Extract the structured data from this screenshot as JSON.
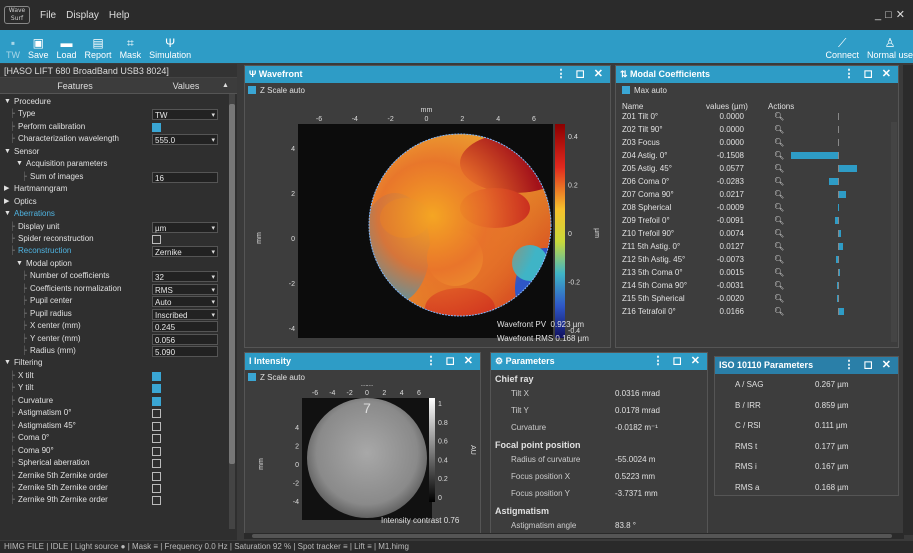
{
  "app": {
    "logo": "Wave Surf",
    "menus": [
      "File",
      "Display",
      "Help"
    ]
  },
  "toolbar": {
    "items": [
      {
        "label": "TW",
        "icon": "camera-icon",
        "enabled": false
      },
      {
        "label": "Save",
        "icon": "save-icon",
        "enabled": true
      },
      {
        "label": "Load",
        "icon": "folder-icon",
        "enabled": true
      },
      {
        "label": "Report",
        "icon": "report-icon",
        "enabled": true
      },
      {
        "label": "Mask",
        "icon": "mask-icon",
        "enabled": true
      },
      {
        "label": "Simulation",
        "icon": "simulation-icon",
        "enabled": true
      }
    ],
    "right": [
      {
        "label": "Connect",
        "icon": "plug-icon"
      },
      {
        "label": "Normal use",
        "icon": "user-icon"
      }
    ]
  },
  "device": {
    "title": "[HASO LIFT 680 BroadBand USB3 8024]"
  },
  "features": {
    "col_features": "Features",
    "col_values": "Values",
    "rows": [
      {
        "label": "Procedure",
        "level": 0,
        "expander": "▼"
      },
      {
        "label": "Type",
        "level": 1,
        "value": "TW",
        "ctrl": "select"
      },
      {
        "label": "Perform calibration",
        "level": 1,
        "ctrl": "check",
        "checked": true
      },
      {
        "label": "Characterization wavelength",
        "level": 1,
        "value": "555.0",
        "ctrl": "spin"
      },
      {
        "label": "Sensor",
        "level": 0,
        "expander": "▼"
      },
      {
        "label": "Acquisition parameters",
        "level": 1,
        "expander": "▼"
      },
      {
        "label": "Sum of images",
        "level": 2,
        "value": "16",
        "ctrl": "text"
      },
      {
        "label": "Hartmanngram",
        "level": 0,
        "expander": "▶"
      },
      {
        "label": "Optics",
        "level": 0,
        "expander": "▶"
      },
      {
        "label": "Aberrations",
        "level": 0,
        "expander": "▼",
        "accent": true
      },
      {
        "label": "Display unit",
        "level": 1,
        "value": "µm",
        "ctrl": "select"
      },
      {
        "label": "Spider reconstruction",
        "level": 1,
        "ctrl": "check",
        "checked": false
      },
      {
        "label": "Reconstruction",
        "level": 1,
        "value": "Zernike",
        "ctrl": "select",
        "accent": true
      },
      {
        "label": "Modal option",
        "level": 1,
        "expander": "▼"
      },
      {
        "label": "Number of coefficients",
        "level": 2,
        "value": "32",
        "ctrl": "spin"
      },
      {
        "label": "Coefficients normalization",
        "level": 2,
        "value": "RMS",
        "ctrl": "select"
      },
      {
        "label": "Pupil center",
        "level": 2,
        "value": "Auto",
        "ctrl": "select"
      },
      {
        "label": "Pupil radius",
        "level": 2,
        "value": "Inscribed",
        "ctrl": "select"
      },
      {
        "label": "X center (mm)",
        "level": 2,
        "value": "0.245",
        "ctrl": "text"
      },
      {
        "label": "Y center (mm)",
        "level": 2,
        "value": "0.056",
        "ctrl": "text"
      },
      {
        "label": "Radius (mm)",
        "level": 2,
        "value": "5.090",
        "ctrl": "text"
      },
      {
        "label": "Filtering",
        "level": 0,
        "expander": "▼"
      },
      {
        "label": "X tilt",
        "level": 1,
        "ctrl": "check",
        "checked": true
      },
      {
        "label": "Y tilt",
        "level": 1,
        "ctrl": "check",
        "checked": true
      },
      {
        "label": "Curvature",
        "level": 1,
        "ctrl": "check",
        "checked": true
      },
      {
        "label": "Astigmatism 0°",
        "level": 1,
        "ctrl": "check",
        "checked": false
      },
      {
        "label": "Astigmatism 45°",
        "level": 1,
        "ctrl": "check",
        "checked": false
      },
      {
        "label": "Coma 0°",
        "level": 1,
        "ctrl": "check",
        "checked": false
      },
      {
        "label": "Coma 90°",
        "level": 1,
        "ctrl": "check",
        "checked": false
      },
      {
        "label": "Spherical aberration",
        "level": 1,
        "ctrl": "check",
        "checked": false
      },
      {
        "label": "Zernike 5th Zernike order",
        "level": 1,
        "ctrl": "check",
        "checked": false
      },
      {
        "label": "Zernike 5th Zernike order",
        "level": 1,
        "ctrl": "check",
        "checked": false
      },
      {
        "label": "Zernike 9th Zernike order",
        "level": 1,
        "ctrl": "check",
        "checked": false
      }
    ]
  },
  "wavefront": {
    "title": "Wavefront",
    "zscale": "Z Scale auto",
    "axis_unit": "mm",
    "colorbar_unit": "µm",
    "xticks": [
      "-6",
      "-4",
      "-2",
      "0",
      "2",
      "4",
      "6"
    ],
    "yticks": [
      "4",
      "2",
      "0",
      "-2",
      "-4"
    ],
    "cticks": [
      "0.4",
      "0.2",
      "0",
      "-0.2",
      "-0.4"
    ],
    "pv_label": "Wavefront PV",
    "pv_value": "0.923 µm",
    "rms_label": "Wavefront RMS",
    "rms_value": "0.168 µm"
  },
  "intensity": {
    "title": "Intensity",
    "zscale": "Z Scale auto",
    "axis_unit": "mm",
    "colorbar_unit": "AU",
    "xticks": [
      "-6",
      "-4",
      "-2",
      "0",
      "2",
      "4",
      "6"
    ],
    "yticks": [
      "4",
      "2",
      "0",
      "-2",
      "-4"
    ],
    "cticks": [
      "1",
      "0.8",
      "0.6",
      "0.4",
      "0.2",
      "0"
    ],
    "contrast_label": "Intensity contrast",
    "contrast_value": "0.76"
  },
  "modal": {
    "title": "Modal Coefficients",
    "max_auto": "Max auto",
    "col_name": "Name",
    "col_values": "values (µm)",
    "col_actions": "Actions",
    "rows": [
      {
        "name": "Z01 Tilt 0°",
        "value": "0.0000",
        "v": 0
      },
      {
        "name": "Z02 Tilt 90°",
        "value": "0.0000",
        "v": 0
      },
      {
        "name": "Z03 Focus",
        "value": "0.0000",
        "v": 0
      },
      {
        "name": "Z04 Astig. 0°",
        "value": "-0.1508",
        "v": -0.1508
      },
      {
        "name": "Z05 Astig. 45°",
        "value": "0.0577",
        "v": 0.0577
      },
      {
        "name": "Z06 Coma 0°",
        "value": "-0.0283",
        "v": -0.0283
      },
      {
        "name": "Z07 Coma 90°",
        "value": "0.0217",
        "v": 0.0217
      },
      {
        "name": "Z08 Spherical",
        "value": "-0.0009",
        "v": -0.0009
      },
      {
        "name": "Z09 Trefoil 0°",
        "value": "-0.0091",
        "v": -0.0091
      },
      {
        "name": "Z10 Trefoil 90°",
        "value": "0.0074",
        "v": 0.0074
      },
      {
        "name": "Z11 5th Astig. 0°",
        "value": "0.0127",
        "v": 0.0127
      },
      {
        "name": "Z12 5th Astig. 45°",
        "value": "-0.0073",
        "v": -0.0073
      },
      {
        "name": "Z13 5th Coma 0°",
        "value": "0.0015",
        "v": 0.0015
      },
      {
        "name": "Z14 5th Coma 90°",
        "value": "-0.0031",
        "v": -0.0031
      },
      {
        "name": "Z15 5th Spherical",
        "value": "-0.0020",
        "v": -0.002
      },
      {
        "name": "Z16 Tetrafoil 0°",
        "value": "0.0166",
        "v": 0.0166
      }
    ]
  },
  "parameters": {
    "title": "Parameters",
    "sections": [
      {
        "heading": "Chief ray",
        "rows": [
          {
            "label": "Tilt X",
            "value": "0.0316 mrad"
          },
          {
            "label": "Tilt Y",
            "value": "0.0178 mrad"
          },
          {
            "label": "Curvature",
            "value": "-0.0182 m⁻¹"
          }
        ]
      },
      {
        "heading": "Focal point position",
        "rows": [
          {
            "label": "Radius of curvature",
            "value": "-55.0024 m"
          },
          {
            "label": "Focus position X",
            "value": "0.5223 mm"
          },
          {
            "label": "Focus position Y",
            "value": "-3.7371 mm"
          }
        ]
      },
      {
        "heading": "Astigmatism",
        "rows": [
          {
            "label": "Astigmatism angle",
            "value": "83.8 °"
          }
        ]
      }
    ]
  },
  "iso": {
    "title": "ISO 10110 Parameters",
    "rows": [
      {
        "label": "A / SAG",
        "value": "0.267 µm"
      },
      {
        "label": "B / IRR",
        "value": "0.859 µm"
      },
      {
        "label": "C / RSI",
        "value": "0.111 µm"
      },
      {
        "label": "RMS t",
        "value": "0.177 µm"
      },
      {
        "label": "RMS i",
        "value": "0.167 µm"
      },
      {
        "label": "RMS a",
        "value": "0.168 µm"
      }
    ]
  },
  "status": {
    "text": "HIMG FILE    |  IDLE     | Light source  ●  | Mask  ≡  | Frequency  0.0 Hz  | Saturation    92 %  | Spot tracker  ≡  | Lift  ≡  | M1.himg"
  }
}
